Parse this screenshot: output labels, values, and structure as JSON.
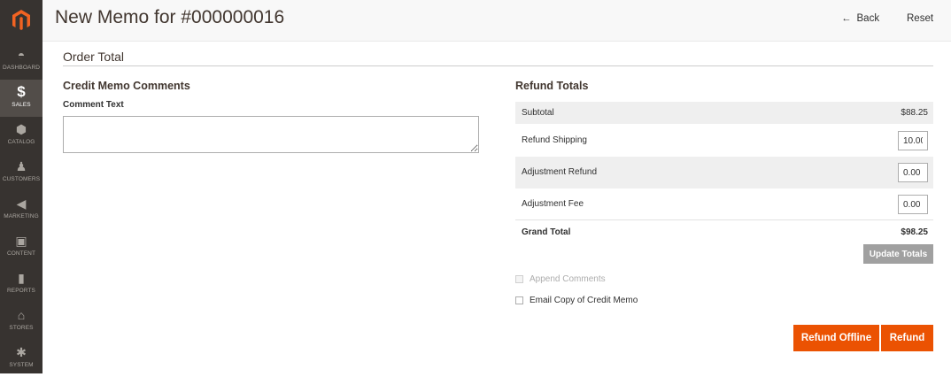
{
  "sidebar": {
    "logo": "magento-logo",
    "items": [
      {
        "label": "DASHBOARD",
        "icon": "gauge-icon",
        "glyph": "◓",
        "active": false
      },
      {
        "label": "SALES",
        "icon": "dollar-icon",
        "glyph": "$",
        "active": true
      },
      {
        "label": "CATALOG",
        "icon": "cube-icon",
        "glyph": "⬢",
        "active": false
      },
      {
        "label": "CUSTOMERS",
        "icon": "person-icon",
        "glyph": "♟",
        "active": false
      },
      {
        "label": "MARKETING",
        "icon": "megaphone-icon",
        "glyph": "◀",
        "active": false
      },
      {
        "label": "CONTENT",
        "icon": "layout-icon",
        "glyph": "▣",
        "active": false
      },
      {
        "label": "REPORTS",
        "icon": "bar-chart-icon",
        "glyph": "▮",
        "active": false
      },
      {
        "label": "STORES",
        "icon": "storefront-icon",
        "glyph": "⌂",
        "active": false
      },
      {
        "label": "SYSTEM",
        "icon": "gear-icon",
        "glyph": "✱",
        "active": false
      }
    ]
  },
  "header": {
    "title": "New Memo for #000000016",
    "back_arrow": "←",
    "back_label": "Back",
    "reset_label": "Reset"
  },
  "order_total": {
    "section_title": "Order Total"
  },
  "comments": {
    "title": "Credit Memo Comments",
    "comment_label": "Comment Text",
    "comment_value": ""
  },
  "refund_totals": {
    "title": "Refund Totals",
    "subtotal_label": "Subtotal",
    "subtotal_value": "$88.25",
    "refund_shipping_label": "Refund Shipping",
    "refund_shipping_value": "10.00",
    "adjustment_refund_label": "Adjustment Refund",
    "adjustment_refund_value": "0.00",
    "adjustment_fee_label": "Adjustment Fee",
    "adjustment_fee_value": "0.00",
    "grand_total_label": "Grand Total",
    "grand_total_value": "$98.25",
    "update_button": "Update Totals"
  },
  "options": {
    "append_comments": "Append Comments",
    "email_copy": "Email Copy of Credit Memo"
  },
  "actions": {
    "refund_offline": "Refund Offline",
    "refund": "Refund"
  },
  "colors": {
    "accent": "#eb5202",
    "sidebar": "#373330",
    "sidebar_active": "#524d49"
  }
}
